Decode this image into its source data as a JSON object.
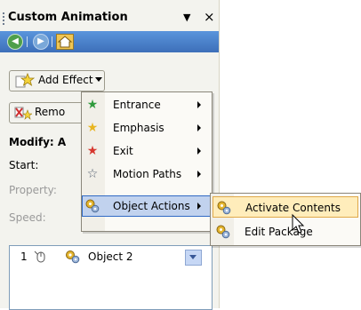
{
  "pane": {
    "title": "Custom Animation",
    "buttons": {
      "add_effect": "Add Effect",
      "remove": "Remo"
    },
    "labels": {
      "modify": "Modify: A",
      "start": "Start:",
      "property": "Property:",
      "speed": "Speed:"
    },
    "list": {
      "row": {
        "number": "1",
        "name": "Object 2"
      }
    }
  },
  "menu": {
    "items": [
      {
        "label": "Entrance",
        "icon": "green-star-icon"
      },
      {
        "label": "Emphasis",
        "icon": "yellow-star-icon"
      },
      {
        "label": "Exit",
        "icon": "red-star-icon"
      },
      {
        "label": "Motion Paths",
        "icon": "outline-star-icon"
      },
      {
        "label": "Object Actions",
        "icon": "gears-icon"
      }
    ]
  },
  "submenu": {
    "items": [
      {
        "label": "Activate Contents",
        "icon": "gears-icon"
      },
      {
        "label": "Edit Package",
        "icon": "gears-icon"
      }
    ]
  }
}
